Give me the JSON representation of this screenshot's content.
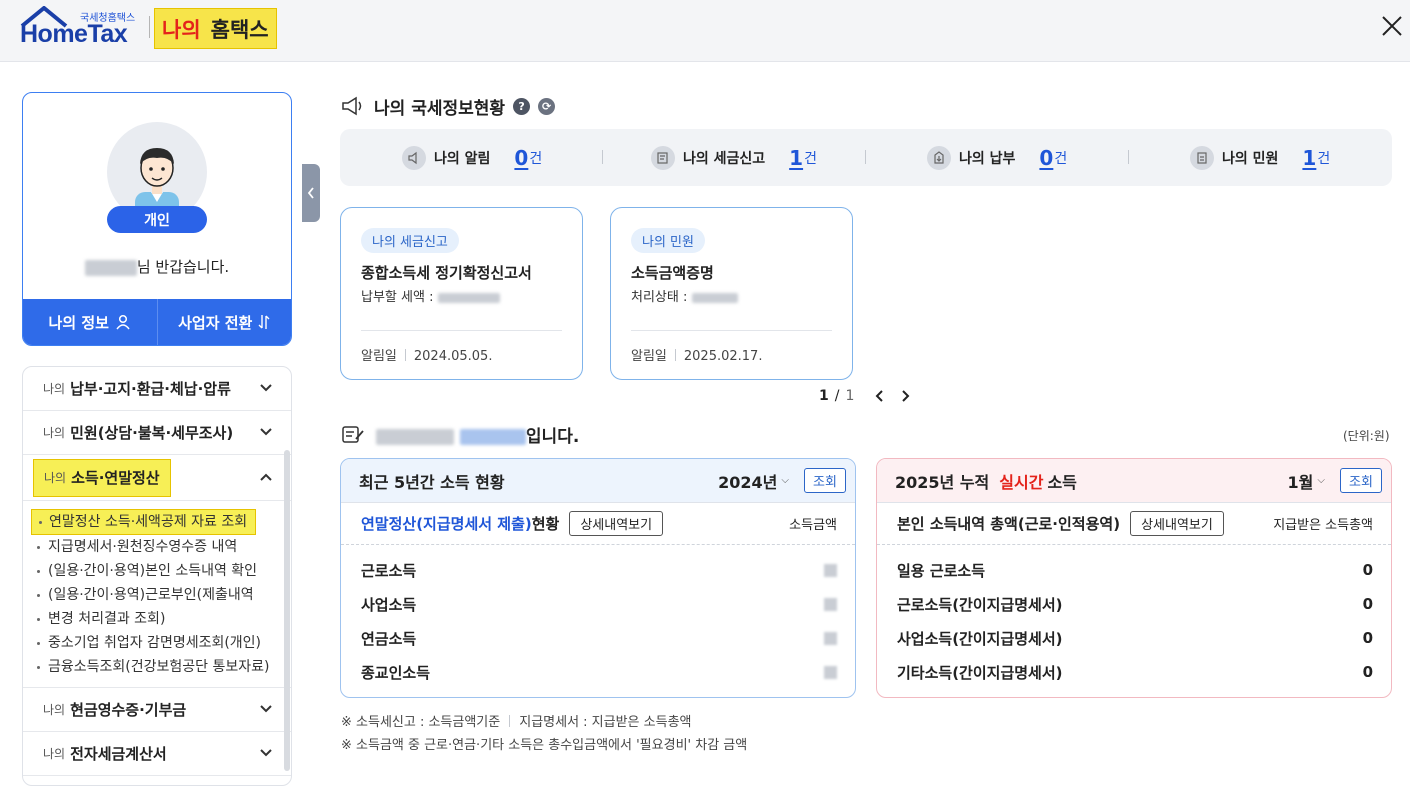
{
  "header": {
    "logo_small": "국세청홈택스",
    "logo_main": "HomeTax",
    "my_prefix": "나의",
    "my_suffix": "홈택스",
    "close_icon": "close-icon"
  },
  "profile": {
    "badge": "개인",
    "greeting_suffix": "님 반갑습니다.",
    "my_info": "나의 정보",
    "switch_business": "사업자 전환"
  },
  "menu": {
    "sections": [
      {
        "prefix": "나의",
        "title": "납부·고지·환급·체납·압류"
      },
      {
        "prefix": "나의",
        "title": "민원(상담·불복·세무조사)"
      },
      {
        "prefix": "나의",
        "title": "소득·연말정산"
      },
      {
        "prefix": "나의",
        "title": "현금영수증·기부금"
      },
      {
        "prefix": "나의",
        "title": "전자세금계산서"
      }
    ],
    "sub_items": [
      "연말정산 소득·세액공제 자료 조회",
      "지급명세서·원천징수영수증 내역",
      "(일용·간이·용역)본인 소득내역 확인",
      "(일용·간이·용역)근로부인(제출내역",
      "변경 처리결과 조회)",
      "중소기업 취업자 감면명세조회(개인)",
      "금융소득조회(건강보험공단 통보자료)"
    ]
  },
  "status": {
    "title": "나의 국세정보현황",
    "help": "?",
    "refresh": "⟳",
    "items": [
      {
        "label": "나의 알림",
        "count": "0",
        "unit": "건"
      },
      {
        "label": "나의 세금신고",
        "count": "1",
        "unit": "건"
      },
      {
        "label": "나의 납부",
        "count": "0",
        "unit": "건"
      },
      {
        "label": "나의 민원",
        "count": "1",
        "unit": "건"
      }
    ]
  },
  "cards": [
    {
      "tag": "나의 세금신고",
      "title": "종합소득세 정기확정신고서",
      "desc_label": "납부할 세액 :",
      "date_label": "알림일",
      "date": "2024.05.05."
    },
    {
      "tag": "나의 민원",
      "title": "소득금액증명",
      "desc_label": "처리상태 :",
      "date_label": "알림일",
      "date": "2025.02.17."
    }
  ],
  "pager": {
    "current": "1",
    "sep": "/",
    "total": "1",
    "prev": "‹",
    "next": "›"
  },
  "income": {
    "title_suffix": "입니다.",
    "unit": "(단위:원)",
    "left": {
      "title": "최근 5년간 소득 현황",
      "year": "2024년",
      "query": "조회",
      "sub_blue": "연말정산(지급명세서 제출)",
      "sub_rest": " 현황",
      "detail": "상세내역보기",
      "col": "소득금액",
      "rows": [
        "근로소득",
        "사업소득",
        "연금소득",
        "종교인소득"
      ]
    },
    "right": {
      "title_pre": "2025년 누적",
      "title_red": "실시간",
      "title_post": "소득",
      "month": "1월",
      "query": "조회",
      "sub": "본인 소득내역 총액(근로·인적용역)",
      "detail": "상세내역보기",
      "col": "지급받은 소득총액",
      "rows": [
        {
          "label": "일용 근로소득",
          "value": "0"
        },
        {
          "label": "근로소득(간이지급명세서)",
          "value": "0"
        },
        {
          "label": "사업소득(간이지급명세서)",
          "value": "0"
        },
        {
          "label": "기타소득(간이지급명세서)",
          "value": "0"
        }
      ]
    },
    "notes": {
      "line1a": "※ 소득세신고 : 소득금액기준",
      "line1b": "지급명세서 : 지급받은 소득총액",
      "line2": "※ 소득금액 중 근로·연금·기타 소득은 총수입금액에서 '필요경비' 차감 금액"
    }
  }
}
